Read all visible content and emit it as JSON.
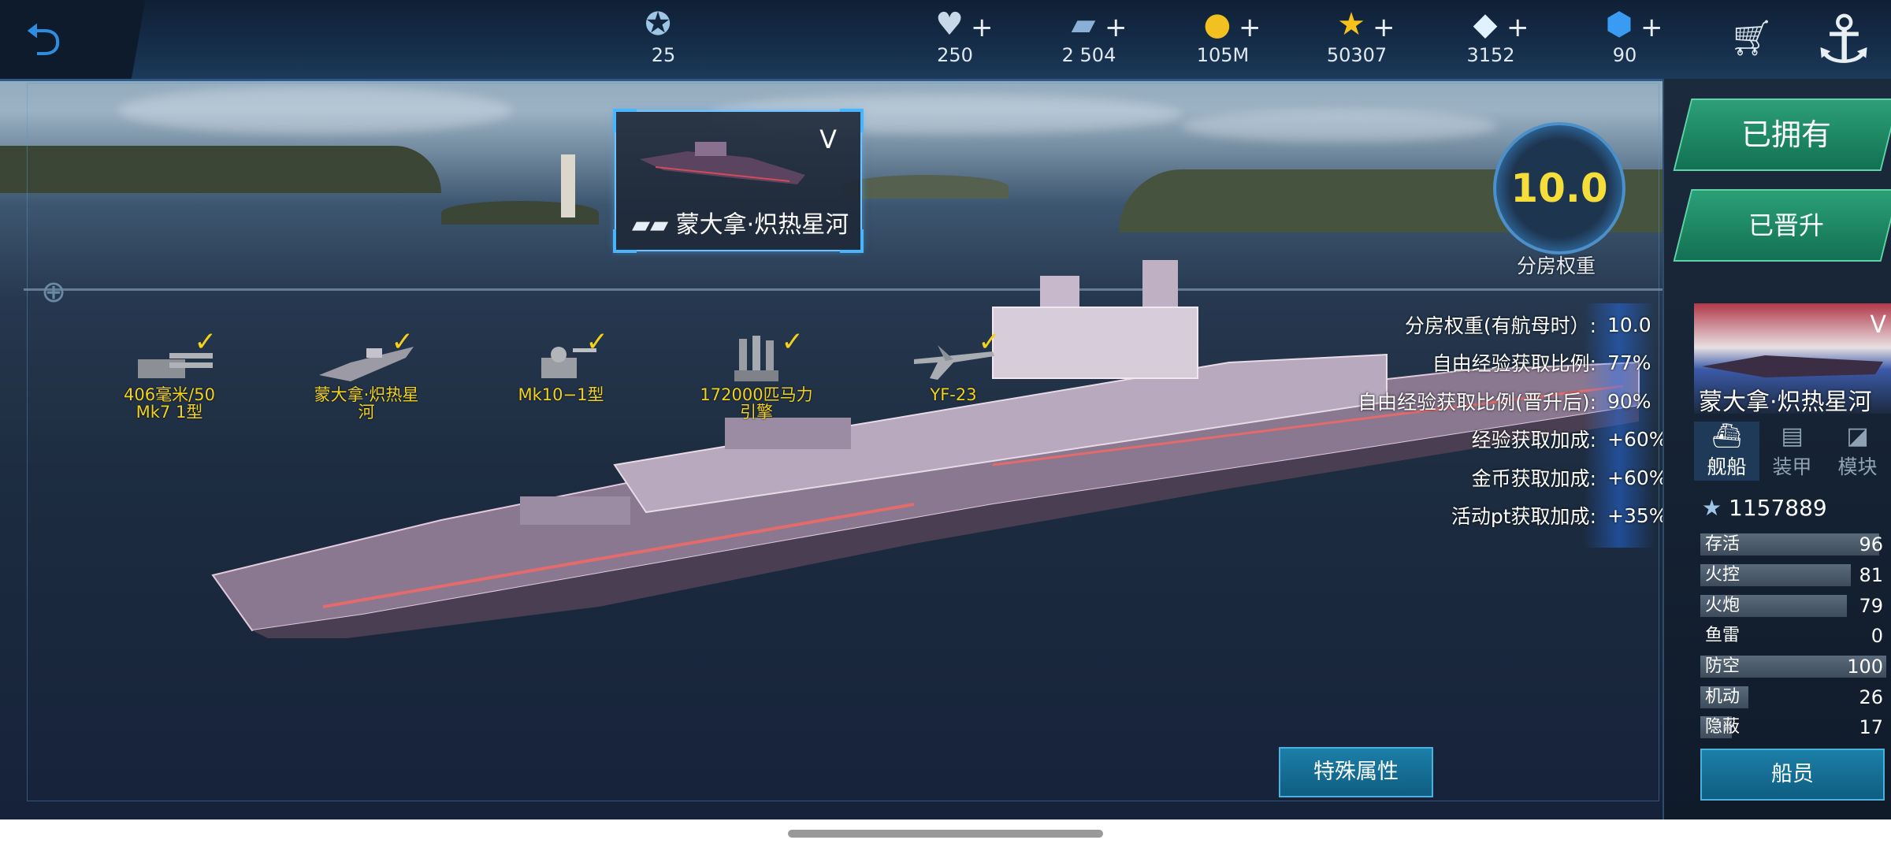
{
  "topbar": {
    "resources": [
      {
        "id": "rank",
        "icon": "rank-star-badge-icon",
        "value": "25",
        "has_plus": false
      },
      {
        "id": "hearts",
        "icon": "heart-icon",
        "value": "250",
        "has_plus": true
      },
      {
        "id": "cards",
        "icon": "card-icon",
        "value": "2 504",
        "has_plus": true
      },
      {
        "id": "gold",
        "icon": "gold-coin-icon",
        "value": "105M",
        "has_plus": true
      },
      {
        "id": "stars",
        "icon": "gold-star-icon",
        "value": "50307",
        "has_plus": true
      },
      {
        "id": "diamonds",
        "icon": "diamond-icon",
        "value": "3152",
        "has_plus": true
      },
      {
        "id": "gems",
        "icon": "blue-gem-icon",
        "value": "90",
        "has_plus": true
      }
    ]
  },
  "selected_ship": {
    "tier": "V",
    "name": "蒙大拿·炽热星河"
  },
  "equipment": [
    {
      "label": "406毫米/50\nMk7 1型"
    },
    {
      "label": "蒙大拿·炽热星\n河"
    },
    {
      "label": "Mk10−1型"
    },
    {
      "label": "172000匹马力\n引擎"
    },
    {
      "label": "YF-23"
    }
  ],
  "weight_dial": {
    "value": "10.0",
    "label": "分房权重"
  },
  "ship_stats": [
    {
      "label": "分房权重(有航母时）:",
      "value": "10.0"
    },
    {
      "label": "自由经验获取比例:",
      "value": "77%"
    },
    {
      "label": "自由经验获取比例(晋升后):",
      "value": "90%"
    },
    {
      "label": "经验获取加成:",
      "value": "+60%"
    },
    {
      "label": "金币获取加成:",
      "value": "+60%"
    },
    {
      "label": "活动pt获取加成:",
      "value": "+35%"
    }
  ],
  "buttons": {
    "owned": "已拥有",
    "promoted": "已晋升",
    "special": "特殊属性",
    "crew": "船员"
  },
  "side_panel": {
    "ship_tier": "V",
    "ship_name": "蒙大拿·炽热星河",
    "tabs": [
      {
        "label": "舰船",
        "icon": "ship-icon",
        "active": true
      },
      {
        "label": "装甲",
        "icon": "armor-icon",
        "active": false
      },
      {
        "label": "模块",
        "icon": "module-icon",
        "active": false
      }
    ],
    "power": "1157889",
    "attributes": [
      {
        "label": "存活",
        "value": "96",
        "level": 0.96
      },
      {
        "label": "火控",
        "value": "81",
        "level": 0.81
      },
      {
        "label": "火炮",
        "value": "79",
        "level": 0.79
      },
      {
        "label": "鱼雷",
        "value": "0",
        "level": 0
      },
      {
        "label": "防空",
        "value": "100",
        "level": 1.0
      },
      {
        "label": "机动",
        "value": "26",
        "level": 0.26
      },
      {
        "label": "隐蔽",
        "value": "17",
        "level": 0.17
      }
    ]
  }
}
